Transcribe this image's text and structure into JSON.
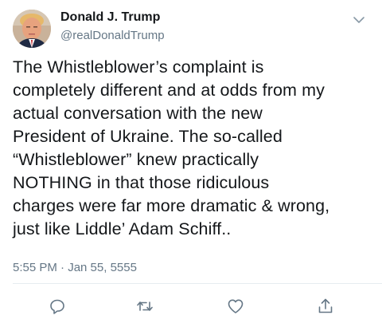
{
  "tweet": {
    "display_name": "Donald J. Trump",
    "handle": "@realDonaldTrump",
    "text": "The Whistleblower’s complaint is\ncompletely different and at odds from my\nactual conversation with the new\nPresident of Ukraine. The so-called\n“Whistleblower” knew practically\nNOTHING in that those ridiculous\ncharges were far more dramatic & wrong,\njust like Liddle’ Adam Schiff..",
    "timestamp": "5:55 PM · Jan 55, 5555"
  },
  "icons": {
    "avatar": "profile-photo",
    "caret": "chevron-down-icon",
    "reply": "reply-icon",
    "retweet": "retweet-icon",
    "like": "heart-icon",
    "share": "share-icon"
  },
  "colors": {
    "text_primary": "#14171a",
    "text_secondary": "#657786",
    "icon": "#657786",
    "divider": "#e6ecf0"
  }
}
